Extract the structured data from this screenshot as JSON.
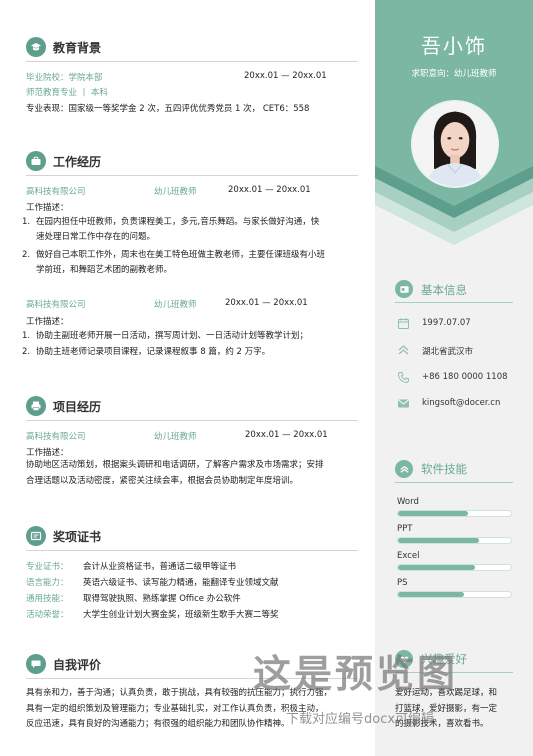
{
  "education": {
    "title": "教育背景",
    "school": "毕业院校：学院本部",
    "dates": "20xx.01 — 20xx.01",
    "major": "师范教育专业 丨 本科",
    "performance": "专业表现：国家级一等奖学金 2 次，五四评优优秀党员 1 次，  CET6：558"
  },
  "work": {
    "title": "工作经历",
    "jobs": [
      {
        "company": "高科技有限公司",
        "role": "幼儿班教师",
        "dates": "20xx.01 — 20xx.01",
        "desc_label": "工作描述：",
        "items": [
          {
            "num": "1.",
            "lines": [
              "在园内担任中班教师，负责课程美工，多元,音乐舞蹈。与家长做好沟通，快",
              "速处理日常工作中存在的问题。"
            ]
          },
          {
            "num": "2.",
            "lines": [
              "做好自己本职工作外，周末也在美工特色班做主教老师，主要任课班级有小班",
              "学前班，和舞蹈艺术团的副教老师。"
            ]
          }
        ]
      },
      {
        "company": "高科技有限公司",
        "role": "幼儿班教师",
        "dates": "20xx.01 — 20xx.01",
        "desc_label": "工作描述：",
        "items": [
          {
            "num": "1.",
            "lines": [
              "协助主副班老师开展一日活动，撰写周计划、一日活动计划等教学计划；"
            ]
          },
          {
            "num": "2.",
            "lines": [
              "协助主班老师记录项目课程，记录课程叙事 8 篇，约 2 万字。"
            ]
          }
        ]
      }
    ]
  },
  "projects": {
    "title": "项目经历",
    "company": "高科技有限公司",
    "role": "幼儿班教师",
    "dates": "20xx.01 — 20xx.01",
    "desc_label": "工作描述：",
    "lines": [
      "协助地区活动策划，根据案头调研和电话调研，了解客户需求及市场需求；安排",
      "合理话题以及活动密度，紧密关注续会率，根据会员协助制定年度培训。"
    ]
  },
  "awards": {
    "title": "奖项证书",
    "rows": [
      {
        "label": "专业证书：",
        "value": "会计从业资格证书，普通话二级甲等证书"
      },
      {
        "label": "语言能力：",
        "value": "英语六级证书、读写能力精通，能翻译专业领域文献"
      },
      {
        "label": "通用技能：",
        "value": "取得驾驶执照、熟练掌握 Office 办公软件"
      },
      {
        "label": "活动荣誉：",
        "value": "大学生创业计划大赛金奖，班级新生歌手大赛二等奖"
      }
    ]
  },
  "self_eval": {
    "title": "自我评价",
    "lines": [
      "具有亲和力，善于沟通；认真负责，敢于挑战，具有较强的抗压能力；执行力强，",
      "具有一定的组织策划及管理能力；专业基础扎实，对工作认真负责，积极主动，",
      "反应迅速，具有良好的沟通能力；有很强的组织能力和团队协作精神。"
    ]
  },
  "sidebar": {
    "name": "吾小饰",
    "intent": "求职意向：幼儿班教师",
    "basic_title": "基本信息",
    "info": [
      {
        "icon": "calendar-icon",
        "text": "1997.07.07"
      },
      {
        "icon": "location-icon",
        "text": "湖北省武汉市"
      },
      {
        "icon": "phone-icon",
        "text": "+86 180 0000 1108"
      },
      {
        "icon": "mail-icon",
        "text": "kingsoft@docer.cn"
      }
    ],
    "skills_title": "软件技能",
    "skills": [
      {
        "name": "Word",
        "level": 0.62
      },
      {
        "name": "PPT",
        "level": 0.72
      },
      {
        "name": "Excel",
        "level": 0.68
      },
      {
        "name": "PS",
        "level": 0.58
      }
    ],
    "hobby_title": "兴趣爱好",
    "hobby_lines": [
      "爱好运动，喜欢踢足球，和",
      "打篮球，爱好摄影，有一定",
      "的摄影技术，喜欢看书。"
    ]
  },
  "watermark": {
    "main": "这是预览图",
    "sub": "下载对应编号docx可编辑"
  },
  "colors": {
    "accent": "#7cb7a3",
    "accent_text": "#6aa895",
    "icon_bg": "#5e9e8c"
  }
}
